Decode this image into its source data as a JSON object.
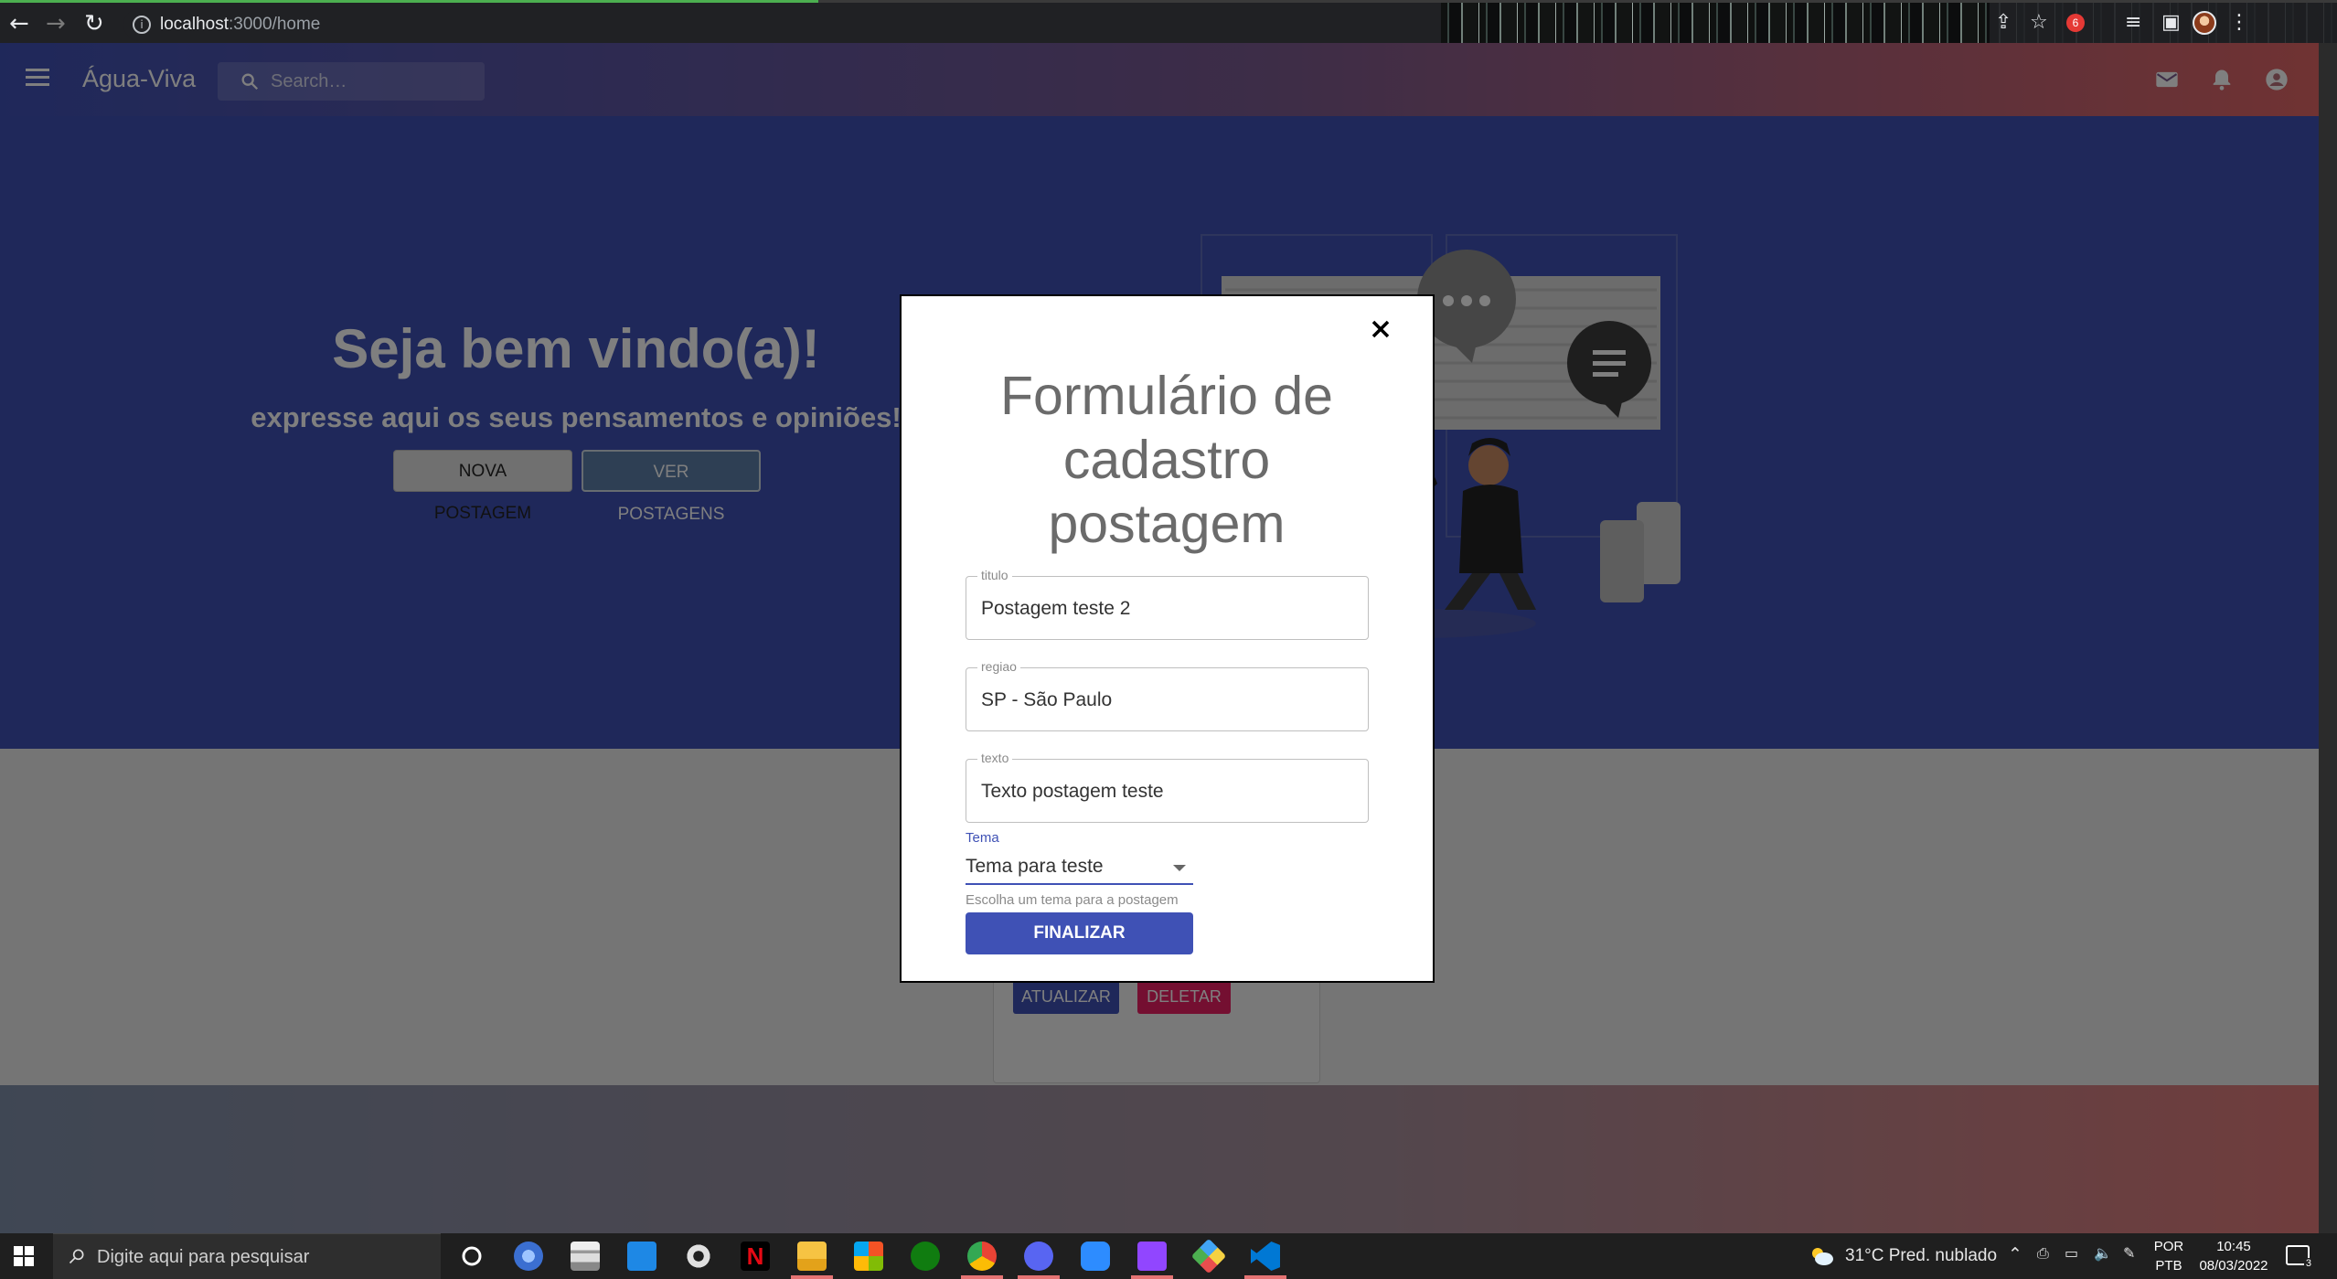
{
  "browser": {
    "url_host": "localhost",
    "url_path": ":3000/home"
  },
  "app": {
    "title": "Água-Viva",
    "search_placeholder": "Search…"
  },
  "hero": {
    "title": "Seja bem vindo(a)!",
    "subtitle": "expresse aqui os seus pensamentos e opiniões!",
    "btn_nova": "NOVA POSTAGEM",
    "btn_ver": "VER POSTAGENS"
  },
  "card": {
    "btn_atualizar": "ATUALIZAR",
    "btn_deletar": "DELETAR"
  },
  "modal": {
    "title": "Formulário de cadastro postagem",
    "fields": [
      {
        "label": "titulo",
        "value": "Postagem teste 2"
      },
      {
        "label": "regiao",
        "value": "SP - São Paulo"
      },
      {
        "label": "texto",
        "value": "Texto postagem teste"
      }
    ],
    "tema_label": "Tema",
    "tema_value": "Tema para teste",
    "tema_help": "Escolha um tema para a postagem",
    "submit": "FINALIZAR"
  },
  "taskbar": {
    "search_placeholder": "Digite aqui para pesquisar",
    "weather": "31°C  Pred. nublado",
    "lang_1": "POR",
    "lang_2": "PTB",
    "time": "10:45",
    "date": "08/03/2022",
    "notif_count": "3"
  },
  "colors": {
    "primary": "#3f51b5",
    "danger": "#e91e63"
  }
}
